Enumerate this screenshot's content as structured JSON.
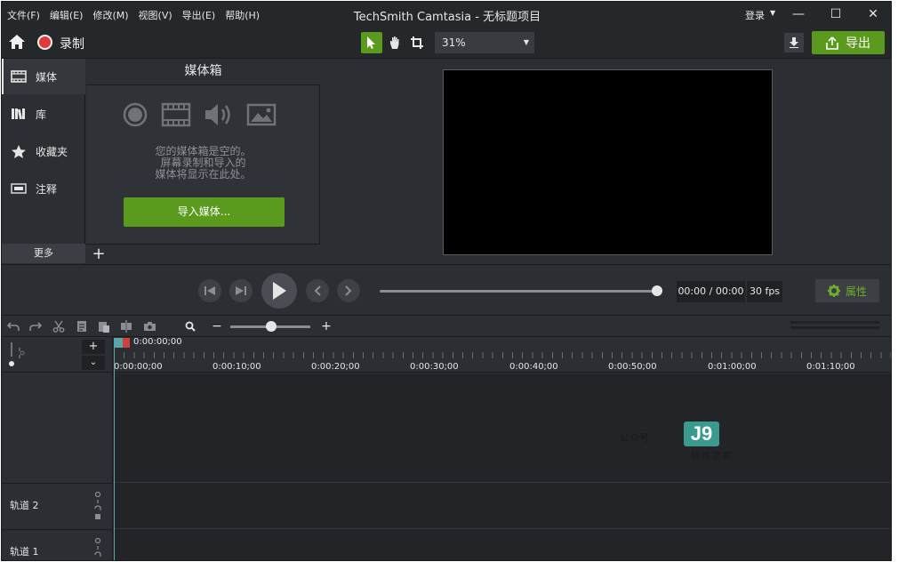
{
  "window": {
    "title": "TechSmith Camtasia - 无标题项目",
    "menu": [
      "文件(F)",
      "编辑(E)",
      "修改(M)",
      "视图(V)",
      "导出(E)",
      "帮助(H)"
    ],
    "login": "登录"
  },
  "toolbar": {
    "record_label": "录制",
    "zoom_value": "31%",
    "export_label": "导出"
  },
  "sidebar": {
    "items": [
      {
        "label": "媒体",
        "icon": "film-icon"
      },
      {
        "label": "库",
        "icon": "library-icon"
      },
      {
        "label": "收藏夹",
        "icon": "star-icon"
      },
      {
        "label": "注释",
        "icon": "annotation-icon"
      }
    ],
    "more_label": "更多"
  },
  "media_bin": {
    "title": "媒体箱",
    "empty_lines": [
      "您的媒体箱是空的。",
      "屏幕录制和导入的",
      "媒体将显示在此处。"
    ],
    "import_label": "导入媒体..."
  },
  "playback": {
    "time": "00:00 / 00:00",
    "fps": "30 fps",
    "properties_label": "属性"
  },
  "timeline": {
    "playhead_time": "0:00:00;00",
    "ruler_labels": [
      "0:00:00;00",
      "0:00:10;00",
      "0:00:20;00",
      "0:00:30;00",
      "0:00:40;00",
      "0:00:50;00",
      "0:01:00;00",
      "0:01:10;00"
    ],
    "tracks": [
      "轨道 2",
      "轨道 1"
    ]
  },
  "watermark": {
    "text": "公众号",
    "logo": "J9",
    "subtitle": "软件之家"
  },
  "colors": {
    "accent_green": "#5a9a1c",
    "record_red": "#e03a3a",
    "panel_bg": "#2b2e32",
    "playhead": "#5ba5a5"
  }
}
